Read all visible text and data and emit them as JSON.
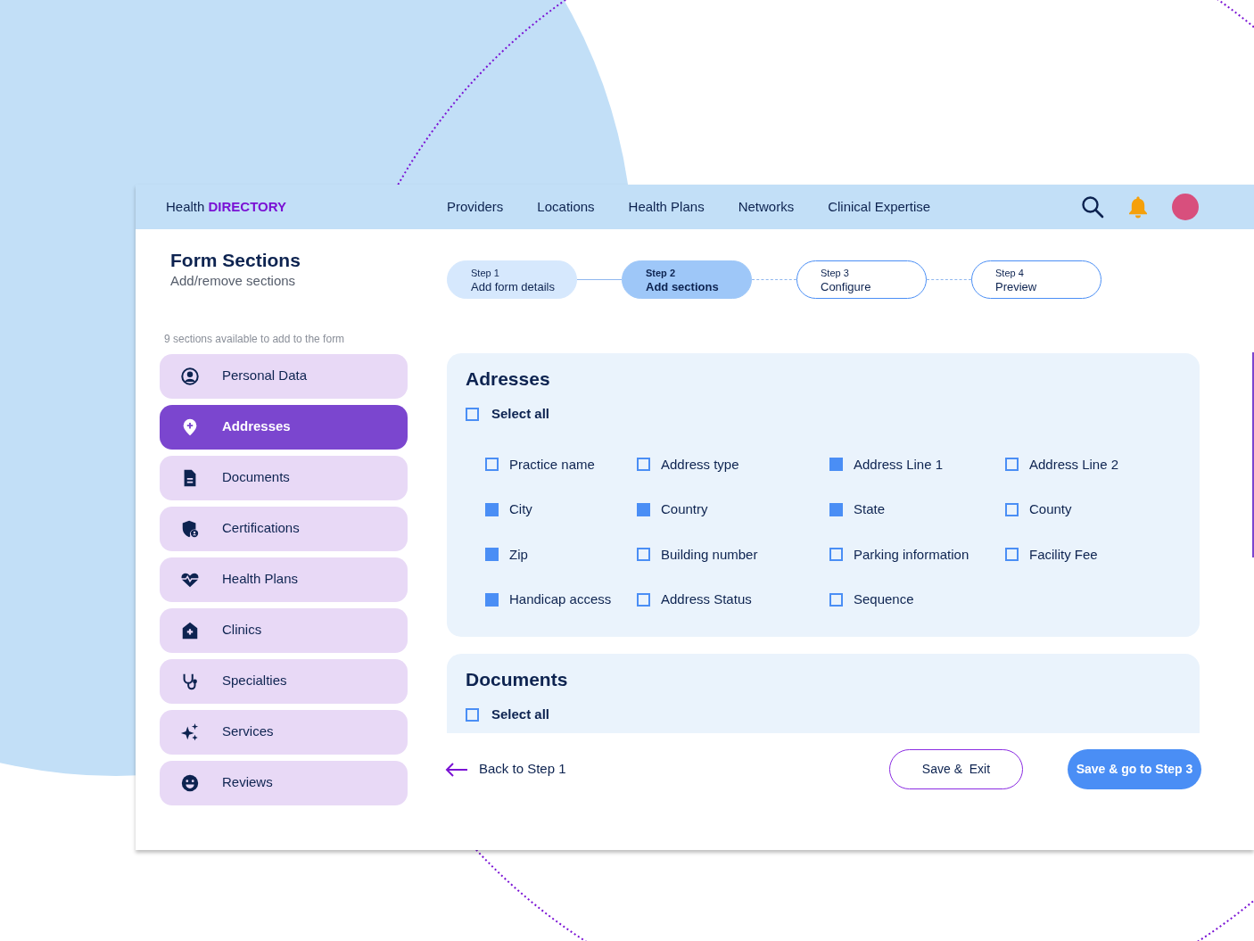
{
  "navbar": {
    "brand_prefix": "Health",
    "brand_name": "DIRECTORY",
    "links": [
      "Providers",
      "Locations",
      "Health Plans",
      "Networks",
      "Clinical Expertise"
    ]
  },
  "header": {
    "title": "Form Sections",
    "subtitle": "Add/remove sections"
  },
  "steps": [
    {
      "step": "Step 1",
      "label": "Add form details",
      "completed": true,
      "selected": false
    },
    {
      "step": "Step 2",
      "label": "Add sections",
      "completed": false,
      "selected": true
    },
    {
      "step": "Step 3",
      "label": "Configure",
      "completed": false,
      "selected": false
    },
    {
      "step": "Step 4",
      "label": "Preview",
      "completed": false,
      "selected": false
    }
  ],
  "sidebar": {
    "caption": "9 sections available to add to the form",
    "items": [
      {
        "label": "Personal Data",
        "selected": false
      },
      {
        "label": "Addresses",
        "selected": true
      },
      {
        "label": "Documents",
        "selected": false
      },
      {
        "label": "Certifications",
        "selected": false
      },
      {
        "label": "Health Plans",
        "selected": false
      },
      {
        "label": "Clinics",
        "selected": false
      },
      {
        "label": "Specialties",
        "selected": false
      },
      {
        "label": "Services",
        "selected": false
      },
      {
        "label": "Reviews",
        "selected": false
      }
    ]
  },
  "sections": [
    {
      "title": "Adresses",
      "select_all": {
        "label": "Select all",
        "checked": false
      },
      "fields": [
        {
          "label": "Practice name",
          "checked": false
        },
        {
          "label": "Address type",
          "checked": false
        },
        {
          "label": "Address Line 1",
          "checked": true
        },
        {
          "label": "Address Line 2",
          "checked": false
        },
        {
          "label": "City",
          "checked": true
        },
        {
          "label": "Country",
          "checked": true
        },
        {
          "label": "State",
          "checked": true
        },
        {
          "label": "County",
          "checked": false
        },
        {
          "label": "Zip",
          "checked": true
        },
        {
          "label": "Building number",
          "checked": false
        },
        {
          "label": "Parking information",
          "checked": false
        },
        {
          "label": "Facility Fee",
          "checked": false
        },
        {
          "label": "Handicap access",
          "checked": true
        },
        {
          "label": "Address Status",
          "checked": false
        },
        {
          "label": "Sequence",
          "checked": false
        }
      ]
    },
    {
      "title": "Documents",
      "select_all": {
        "label": "Select all",
        "checked": false
      }
    }
  ],
  "footer": {
    "back": "Back to Step 1",
    "save_exit": "Save &  Exit",
    "save_next": "Save & go to Step 3"
  }
}
